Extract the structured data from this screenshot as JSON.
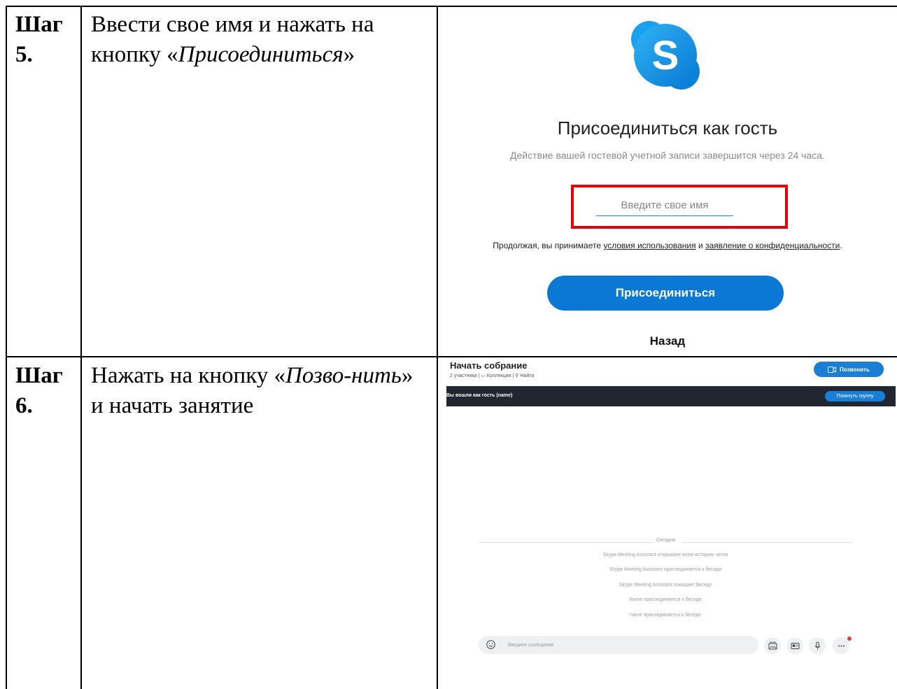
{
  "rows": [
    {
      "step": "Шаг 5.",
      "desc_pre": "Ввести свое имя и нажать на кнопку «",
      "desc_italic": "Присоединиться",
      "desc_post": "»"
    },
    {
      "step": "Шаг 6.",
      "desc_pre": "Нажать на кнопку «",
      "desc_italic": "Позво-нить",
      "desc_post": "» и начать занятие"
    }
  ],
  "join": {
    "logo_letter": "S",
    "title": "Присоединиться как гость",
    "subtitle": "Действие вашей гостевой учетной записи завершится через 24 часа.",
    "name_placeholder": "Введите свое имя",
    "terms_pre": "Продолжая, вы принимаете",
    "terms_link1": "условия использования",
    "terms_mid": "и",
    "terms_link2": "заявление о конфиденциальности",
    "terms_post": ".",
    "join_button": "Присоединиться",
    "back": "Назад",
    "colors": {
      "accent": "#0a78d4",
      "highlight": "#e0000a"
    }
  },
  "meeting": {
    "title": "Начать собрание",
    "participants": "2 участника",
    "collection": "Коллекция",
    "find": "Найти",
    "call_button": "Позвонить",
    "banner_text": "Вы вошли как гость (name)",
    "leave_button": "Покинуть группу",
    "today": "Сегодня",
    "messages": [
      "Skype Meeting Assistant открывает всем историю чатов",
      "Skype Meeting Assistant присоединяется к беседе",
      "Skype Meeting Assistant покидает беседу",
      "Name присоединяется к беседе",
      "name присоединяется к беседе"
    ],
    "compose_placeholder": "Введите сообщение",
    "icons": [
      "smile-icon",
      "gallery-icon",
      "contact-card-icon",
      "microphone-icon",
      "more-icon"
    ]
  }
}
